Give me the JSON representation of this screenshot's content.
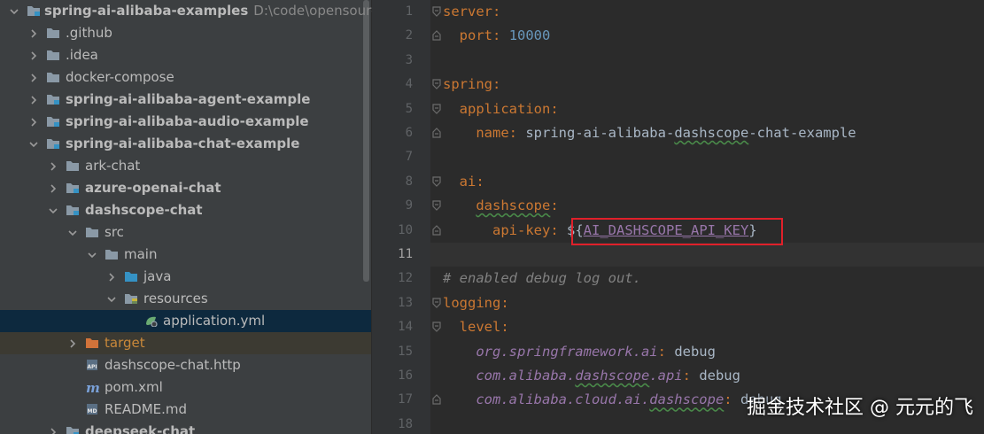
{
  "project_tree": {
    "root": {
      "label": "spring-ai-alibaba-examples",
      "path_hint": "D:\\code\\opensource"
    },
    "items": [
      {
        "label": ".github",
        "depth": 1,
        "expanded": false,
        "bold": false,
        "kind": "folder"
      },
      {
        "label": ".idea",
        "depth": 1,
        "expanded": false,
        "bold": false,
        "kind": "folder"
      },
      {
        "label": "docker-compose",
        "depth": 1,
        "expanded": false,
        "bold": false,
        "kind": "folder"
      },
      {
        "label": "spring-ai-alibaba-agent-example",
        "depth": 1,
        "expanded": false,
        "bold": true,
        "kind": "module"
      },
      {
        "label": "spring-ai-alibaba-audio-example",
        "depth": 1,
        "expanded": false,
        "bold": true,
        "kind": "module"
      },
      {
        "label": "spring-ai-alibaba-chat-example",
        "depth": 1,
        "expanded": true,
        "bold": true,
        "kind": "module"
      },
      {
        "label": "ark-chat",
        "depth": 2,
        "expanded": false,
        "bold": false,
        "kind": "folder"
      },
      {
        "label": "azure-openai-chat",
        "depth": 2,
        "expanded": false,
        "bold": true,
        "kind": "module"
      },
      {
        "label": "dashscope-chat",
        "depth": 2,
        "expanded": true,
        "bold": true,
        "kind": "module"
      },
      {
        "label": "src",
        "depth": 3,
        "expanded": true,
        "bold": false,
        "kind": "folder"
      },
      {
        "label": "main",
        "depth": 4,
        "expanded": true,
        "bold": false,
        "kind": "folder"
      },
      {
        "label": "java",
        "depth": 5,
        "expanded": false,
        "bold": false,
        "kind": "src-folder"
      },
      {
        "label": "resources",
        "depth": 5,
        "expanded": true,
        "bold": false,
        "kind": "res-folder"
      },
      {
        "label": "application.yml",
        "depth": 6,
        "bold": false,
        "kind": "yml-file"
      },
      {
        "label": "target",
        "depth": 3,
        "expanded": false,
        "bold": false,
        "kind": "excluded-folder"
      },
      {
        "label": "dashscope-chat.http",
        "depth": 3,
        "bold": false,
        "kind": "http-file"
      },
      {
        "label": "pom.xml",
        "depth": 3,
        "bold": false,
        "kind": "maven-file"
      },
      {
        "label": "README.md",
        "depth": 3,
        "bold": false,
        "kind": "md-file"
      },
      {
        "label": "deepseek-chat",
        "depth": 2,
        "expanded": false,
        "bold": true,
        "kind": "module"
      }
    ],
    "selected": "application.yml"
  },
  "editor": {
    "file": "application.yml",
    "current_line": 11,
    "lines": [
      {
        "n": "1",
        "text": "server:"
      },
      {
        "n": "2",
        "text": "  port: 10000"
      },
      {
        "n": "3",
        "text": ""
      },
      {
        "n": "4",
        "text": "spring:"
      },
      {
        "n": "5",
        "text": "  application:"
      },
      {
        "n": "6",
        "text": "    name: spring-ai-alibaba-dashscope-chat-example"
      },
      {
        "n": "7",
        "text": ""
      },
      {
        "n": "8",
        "text": "  ai:"
      },
      {
        "n": "9",
        "text": "    dashscope:"
      },
      {
        "n": "10",
        "text": "      api-key: ${AI_DASHSCOPE_API_KEY}"
      },
      {
        "n": "11",
        "text": ""
      },
      {
        "n": "12",
        "text": "# enabled debug log out."
      },
      {
        "n": "13",
        "text": "logging:"
      },
      {
        "n": "14",
        "text": "  level:"
      },
      {
        "n": "15",
        "text": "    org.springframework.ai: debug"
      },
      {
        "n": "16",
        "text": "    com.alibaba.dashscope.api: debug"
      },
      {
        "n": "17",
        "text": "    com.alibaba.cloud.ai.dashscope: debug"
      },
      {
        "n": "18",
        "text": ""
      }
    ],
    "highlighted_value": "${AI_DASHSCOPE_API_KEY}"
  },
  "watermark": "掘金技术社区 @ 元元的飞",
  "colors": {
    "tree_bg": "#3c3f41",
    "editor_bg": "#2b2b2b",
    "gutter_bg": "#313335",
    "selection": "#0d293e",
    "keyword": "#cc7832",
    "number": "#6897bb",
    "comment": "#808080",
    "highlight_box": "#e0202a"
  }
}
